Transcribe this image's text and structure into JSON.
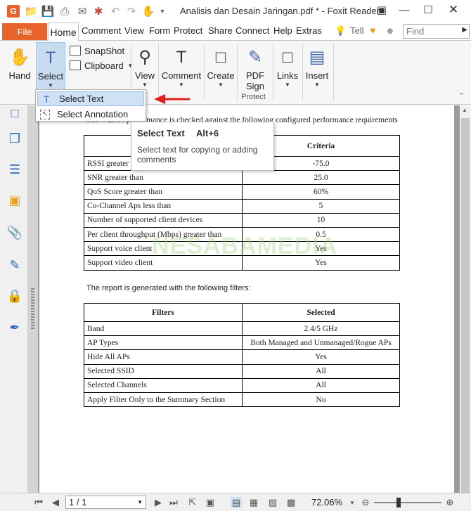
{
  "titlebar": {
    "title": "Analisis dan Desain Jaringan.pdf * - Foxit Reader"
  },
  "menu": {
    "file": "File",
    "home": "Home",
    "tabs": [
      "Comment",
      "View",
      "Form",
      "Protect",
      "Share",
      "Connect",
      "Help",
      "Extras"
    ],
    "tell": "Tell",
    "find_placeholder": "Find"
  },
  "ribbon": {
    "hand": "Hand",
    "select": "Select",
    "snapshot": "SnapShot",
    "clipboard": "Clipboard",
    "view": "View",
    "comment": "Comment",
    "create": "Create",
    "pdf_sign_1": "PDF",
    "pdf_sign_2": "Sign",
    "links": "Links",
    "insert": "Insert",
    "group_protect": "Protect"
  },
  "dropdown": {
    "items": [
      "Select Text",
      "Select Annotation"
    ]
  },
  "tooltip": {
    "title": "Select Text",
    "shortcut": "Alt+6",
    "description": "Select text for copying or adding comments"
  },
  "document": {
    "report_line": "The WLAN performance is checked against the following configured performance requirements",
    "table1": {
      "headers": [
        "",
        "Criteria"
      ],
      "rows": [
        [
          "RSSI greater than",
          "-75.0"
        ],
        [
          "SNR greater than",
          "25.0"
        ],
        [
          "QoS Score greater than",
          "60%"
        ],
        [
          "Co-Channel Aps less than",
          "5"
        ],
        [
          "Number of supported client devices",
          "10"
        ],
        [
          "Per client throughput (Mbps) greater than",
          "0.5"
        ],
        [
          "Support voice client",
          "Yes"
        ],
        [
          "Support video client",
          "Yes"
        ]
      ]
    },
    "filters_note": "The report is generated with the following filters:",
    "table2": {
      "headers": [
        "Filters",
        "Selected"
      ],
      "rows": [
        [
          "Band",
          "2.4/5 GHz"
        ],
        [
          "AP Types",
          "Both Managed and Unmanaged/Rogue APs"
        ],
        [
          "Hide All APs",
          "Yes"
        ],
        [
          "Selected SSID",
          "All"
        ],
        [
          "Selected Channels",
          "All"
        ],
        [
          "Apply Filter Only to the Summary Section",
          "No"
        ]
      ]
    },
    "watermark": "NESABAMEDIA"
  },
  "status": {
    "page": "1 / 1",
    "zoom": "72.06%"
  }
}
